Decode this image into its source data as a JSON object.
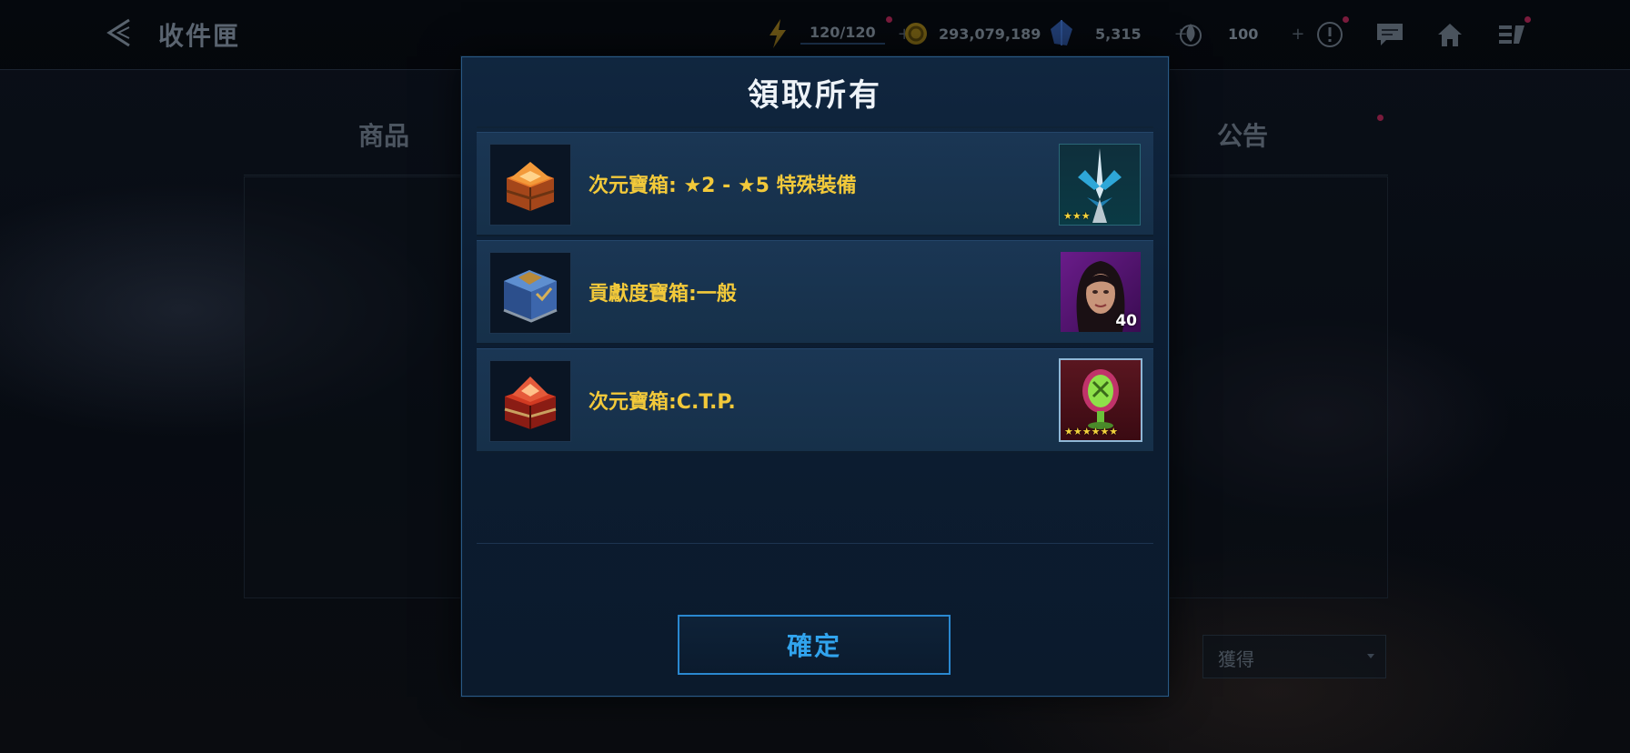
{
  "background": {
    "header_title": "收件匣",
    "resources": [
      {
        "icon": "energy-icon",
        "value": "120/120"
      },
      {
        "icon": "gold-icon",
        "value": "293,079,189"
      },
      {
        "icon": "crystal-icon",
        "value": "5,315"
      },
      {
        "icon": "flame-icon",
        "value": "100"
      }
    ],
    "nav_icons": [
      "alert-icon",
      "chat-icon",
      "home-icon",
      "menu-icon"
    ],
    "tabs": [
      "商品",
      "公告"
    ],
    "filter_dropdown": "獲得"
  },
  "modal": {
    "title": "領取所有",
    "rewards": [
      {
        "chest_icon": "orange-chest-icon",
        "name": "次元寶箱: ★2 - ★5 特殊裝備",
        "item_icon": "blue-sword-emblem-icon",
        "stars": "★★★",
        "quantity": ""
      },
      {
        "chest_icon": "blue-chest-icon",
        "name": "貢獻度寶箱:一般",
        "item_icon": "hero-portrait-icon",
        "stars": "",
        "quantity": "40"
      },
      {
        "chest_icon": "red-chest-icon",
        "name": "次元寶箱:C.T.P.",
        "item_icon": "green-ctp-icon",
        "stars": "★★★★★★",
        "quantity": ""
      }
    ],
    "confirm_label": "確定"
  },
  "colors": {
    "reward_text": "#f2c93a",
    "confirm_accent": "#2a88d0",
    "modal_border": "#2a5a86"
  }
}
